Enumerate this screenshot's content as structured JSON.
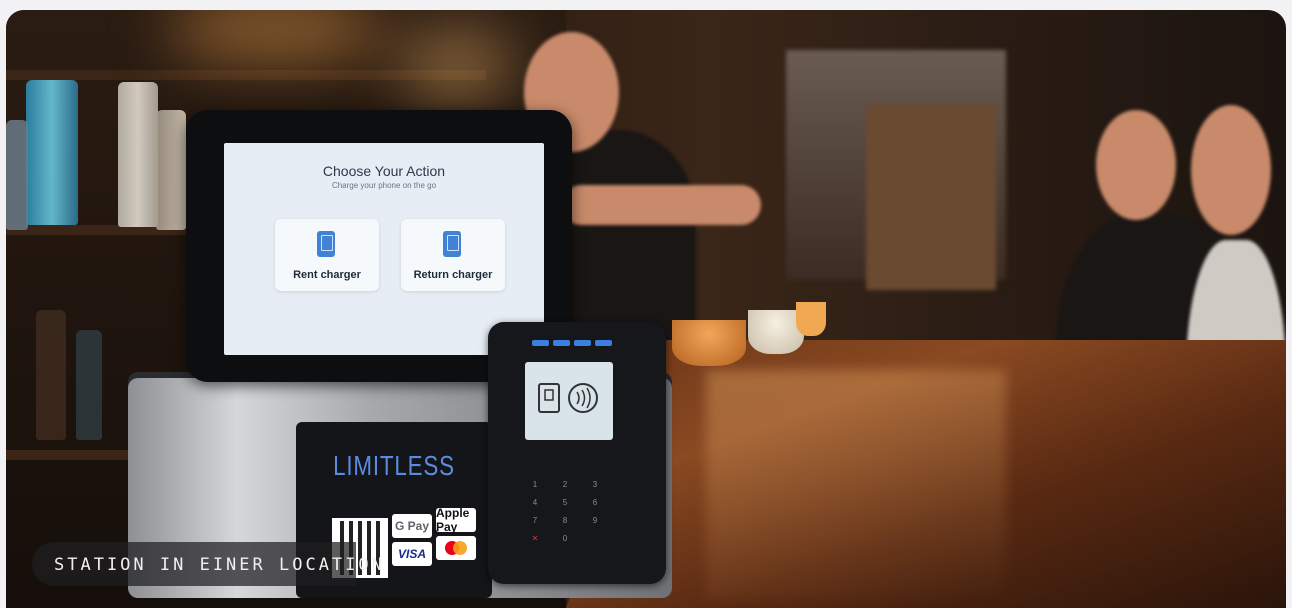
{
  "kiosk": {
    "screen_title": "Choose Your Action",
    "screen_subtitle": "Charge your phone on the go",
    "actions": [
      {
        "label": "Rent charger",
        "icon": "phone-charger-rent-icon"
      },
      {
        "label": "Return charger",
        "icon": "phone-charger-return-icon"
      }
    ]
  },
  "station": {
    "brand": "LIMITLESS",
    "payment_badges": [
      "G Pay",
      "Apple Pay",
      "VISA",
      "Mastercard"
    ]
  },
  "terminal": {
    "keys": [
      "1",
      "2",
      "3",
      "4",
      "5",
      "6",
      "7",
      "8",
      "9",
      "0"
    ]
  },
  "caption": "STATION IN EINER LOCATION",
  "colors": {
    "accent": "#3f82d6",
    "brand_text": "#5a8be0",
    "screen_bg": "#e6edf4"
  }
}
